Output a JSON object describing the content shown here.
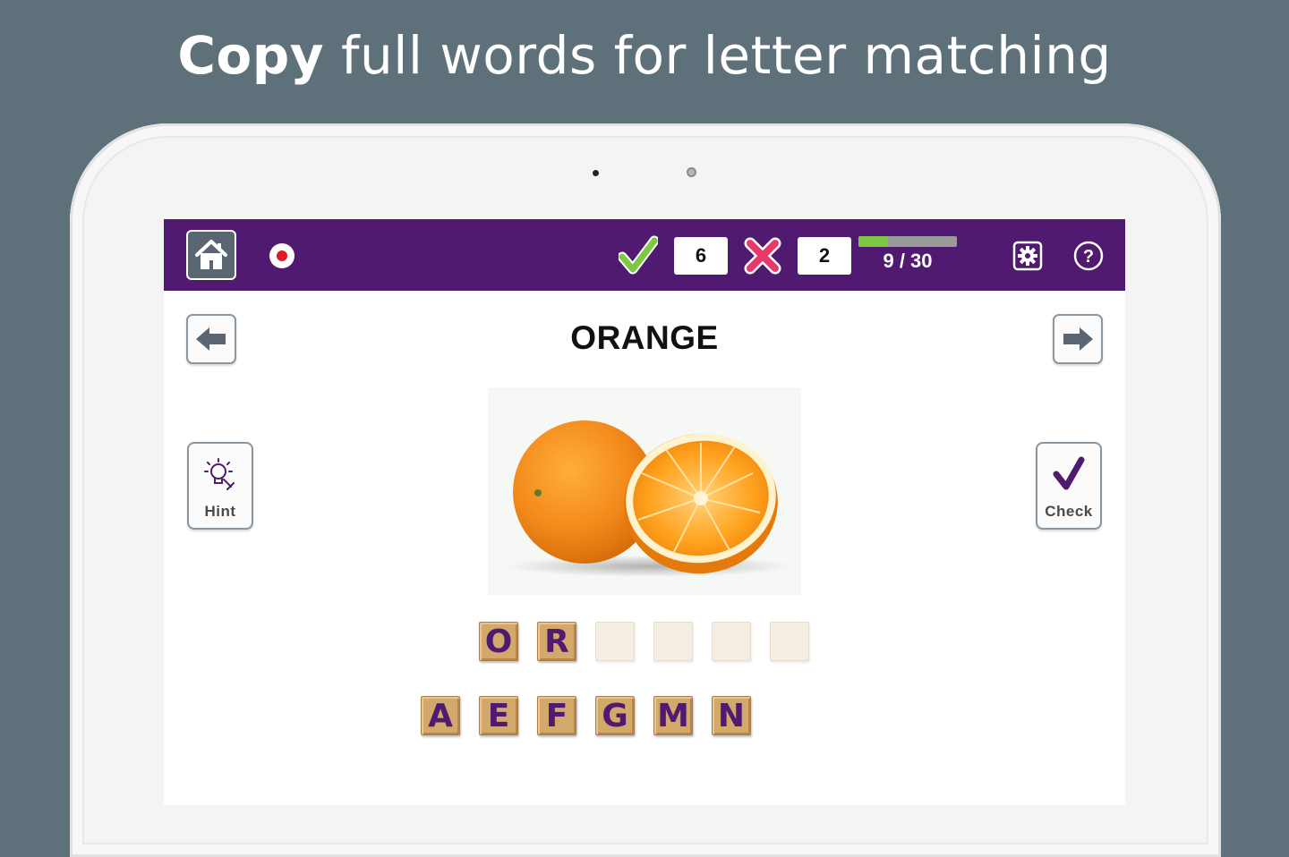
{
  "headline": {
    "bold": "Copy",
    "rest": " full words for letter matching"
  },
  "toolbar": {
    "correct_count": "6",
    "wrong_count": "2",
    "progress_text": "9 / 30",
    "progress_fraction": 0.3,
    "icons": [
      "home-icon",
      "record-icon",
      "checkmark-icon",
      "cross-icon",
      "settings-icon",
      "help-icon"
    ]
  },
  "puzzle": {
    "word": "ORANGE",
    "image": "orange-fruit",
    "answer_slots": [
      "O",
      "R",
      "",
      "",
      "",
      ""
    ],
    "letter_bank": [
      "A",
      "E",
      "F",
      "G",
      "M",
      "N"
    ]
  },
  "buttons": {
    "hint_label": "Hint",
    "check_label": "Check"
  },
  "colors": {
    "topbar": "#4f1a70",
    "tile": "#d3a96b",
    "letter": "#4f1a70",
    "correct": "#7ec843",
    "wrong": "#e83a6a"
  }
}
